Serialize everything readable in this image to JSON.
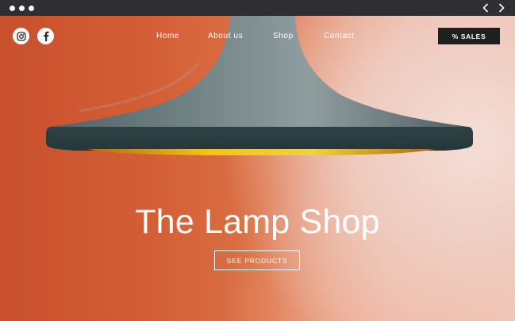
{
  "browser": {
    "window_dots": [
      "dot",
      "dot",
      "dot"
    ],
    "back_icon": "chevron-left-icon",
    "forward_icon": "chevron-right-icon"
  },
  "header": {
    "social": [
      {
        "name": "instagram",
        "icon": "instagram-icon"
      },
      {
        "name": "facebook",
        "icon": "facebook-icon"
      }
    ],
    "nav": [
      {
        "label": "Home"
      },
      {
        "label": "About us"
      },
      {
        "label": "Shop"
      },
      {
        "label": "Contact"
      }
    ],
    "sales_label": "% SALES"
  },
  "hero": {
    "title": "The Lamp Shop",
    "cta_label": "SEE PRODUCTS",
    "image": "pendant-lamp-photo"
  },
  "colors": {
    "background_warm": "#d45f36",
    "background_light": "#efc9bd",
    "button_dark": "#1e1f1f",
    "lamp_shade": "#4d5f63",
    "lamp_inner_glow": "#f2c21a"
  }
}
